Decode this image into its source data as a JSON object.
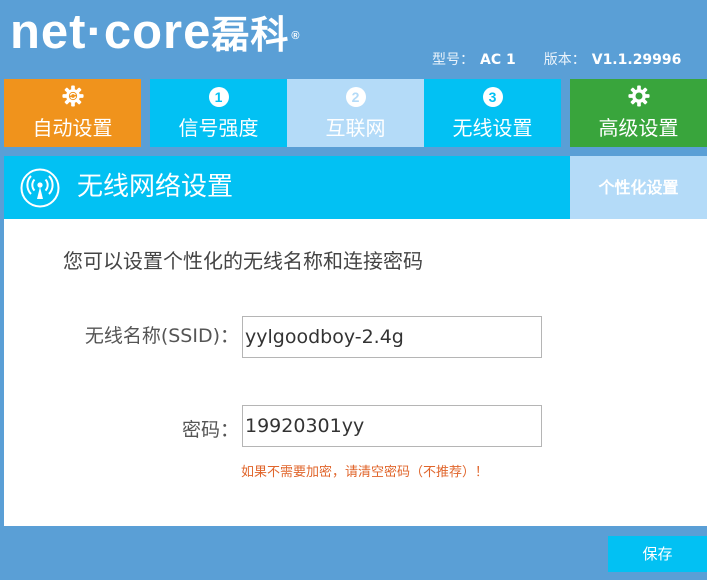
{
  "header": {
    "logo_main": "net·core",
    "logo_cn": "磊科",
    "logo_reg": "®",
    "model_label": "型号：",
    "model_value": "AC 1",
    "version_label": "版本：",
    "version_value": "V1.1.29996"
  },
  "tabs": [
    {
      "label": "自动设置",
      "icon": "gear-icon",
      "color": "#f0931c"
    },
    {
      "label": "信号强度",
      "number": "1",
      "color": "#02c1f3"
    },
    {
      "label": "互联网",
      "number": "2",
      "color": "#b4dbf8",
      "active": true
    },
    {
      "label": "无线设置",
      "number": "3",
      "color": "#02c1f3"
    },
    {
      "label": "高级设置",
      "icon": "gear-icon",
      "color": "#39a53c"
    }
  ],
  "panel": {
    "title": "无线网络设置",
    "icon": "wireless-signal-icon",
    "side_label": "个性化设置",
    "description": "您可以设置个性化的无线名称和连接密码",
    "ssid_label": "无线名称(SSID)：",
    "ssid_value": "yylgoodboy-2.4g",
    "password_label": "密码：",
    "password_value": "19920301yy",
    "hint": "如果不需要加密，请清空密码（不推荐）！"
  },
  "footer": {
    "save_label": "保存"
  },
  "colors": {
    "background": "#5a9fd6",
    "accent_cyan": "#02c1f3",
    "light_blue": "#b4dbf8",
    "orange": "#f0931c",
    "green": "#39a53c",
    "hint_red": "#e0652b"
  }
}
